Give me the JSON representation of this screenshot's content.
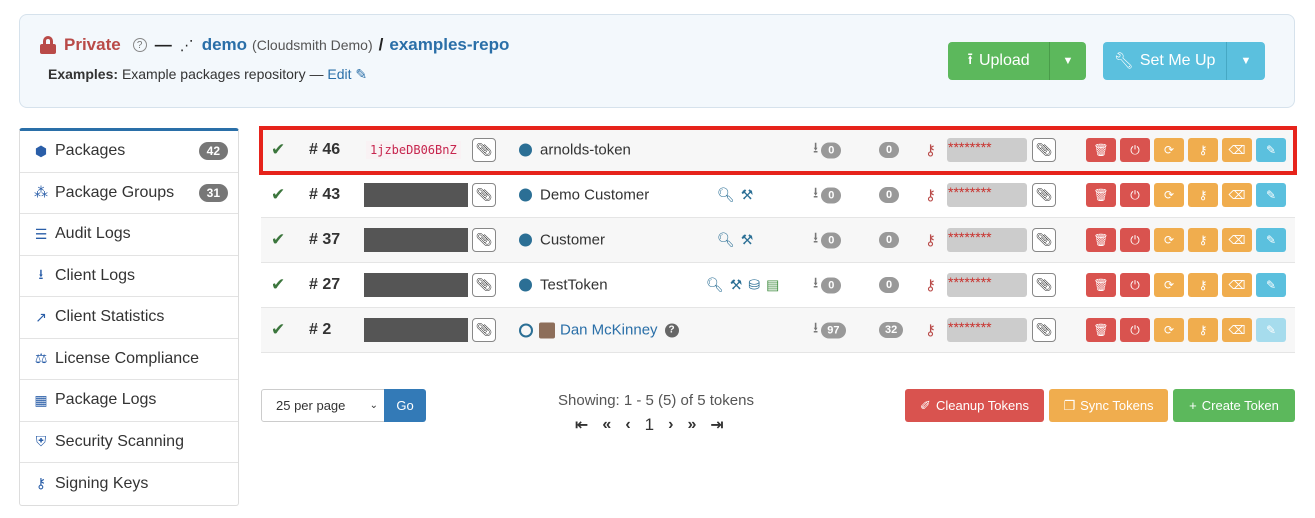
{
  "header": {
    "visibility": "Private",
    "help": "?",
    "separator": "—",
    "owner": "demo",
    "owner_sub": "(Cloudsmith Demo)",
    "slash": "/",
    "repo": "examples-repo",
    "desc_label": "Examples:",
    "desc_text": "Example packages repository",
    "desc_sep": "—",
    "edit": "Edit",
    "upload": "Upload",
    "setup": "Set Me Up"
  },
  "sidebar": {
    "items": [
      {
        "label": "Packages",
        "icon": "cube-icon",
        "badge": "42"
      },
      {
        "label": "Package Groups",
        "icon": "cubes-icon",
        "badge": "31"
      },
      {
        "label": "Audit Logs",
        "icon": "list-icon"
      },
      {
        "label": "Client Logs",
        "icon": "download-icon"
      },
      {
        "label": "Client Statistics",
        "icon": "line-chart-icon"
      },
      {
        "label": "License Compliance",
        "icon": "balance-scale-icon"
      },
      {
        "label": "Package Logs",
        "icon": "table-icon"
      },
      {
        "label": "Security Scanning",
        "icon": "shield-icon"
      },
      {
        "label": "Signing Keys",
        "icon": "key-icon"
      }
    ]
  },
  "tokens": [
    {
      "num": "# 46",
      "code": "1jzbeDB06BnZ",
      "name": "arnolds-token",
      "downloads": "0",
      "count2": "0",
      "secret": "********"
    },
    {
      "num": "# 43",
      "code": "",
      "name": "Demo Customer",
      "downloads": "0",
      "count2": "0",
      "secret": "********"
    },
    {
      "num": "# 37",
      "code": "",
      "name": "Customer",
      "downloads": "0",
      "count2": "0",
      "secret": "********"
    },
    {
      "num": "# 27",
      "code": "",
      "name": "TestToken",
      "downloads": "0",
      "count2": "0",
      "secret": "********"
    },
    {
      "num": "# 2",
      "code": "",
      "name": "Dan McKinney",
      "downloads": "97",
      "count2": "32",
      "secret": "********"
    }
  ],
  "footer": {
    "per_page": "25 per page",
    "go": "Go",
    "showing": "Showing: 1 - 5 (5) of 5 tokens",
    "page": "1",
    "cleanup": "Cleanup Tokens",
    "sync": "Sync Tokens",
    "create": "Create Token"
  },
  "colors": {
    "private": "#b94a48",
    "link": "#2a6fa8",
    "success": "#5cb85c",
    "info": "#5bc0de",
    "danger": "#d9534f",
    "warning": "#f0ad4e",
    "highlight": "#e6231b"
  }
}
